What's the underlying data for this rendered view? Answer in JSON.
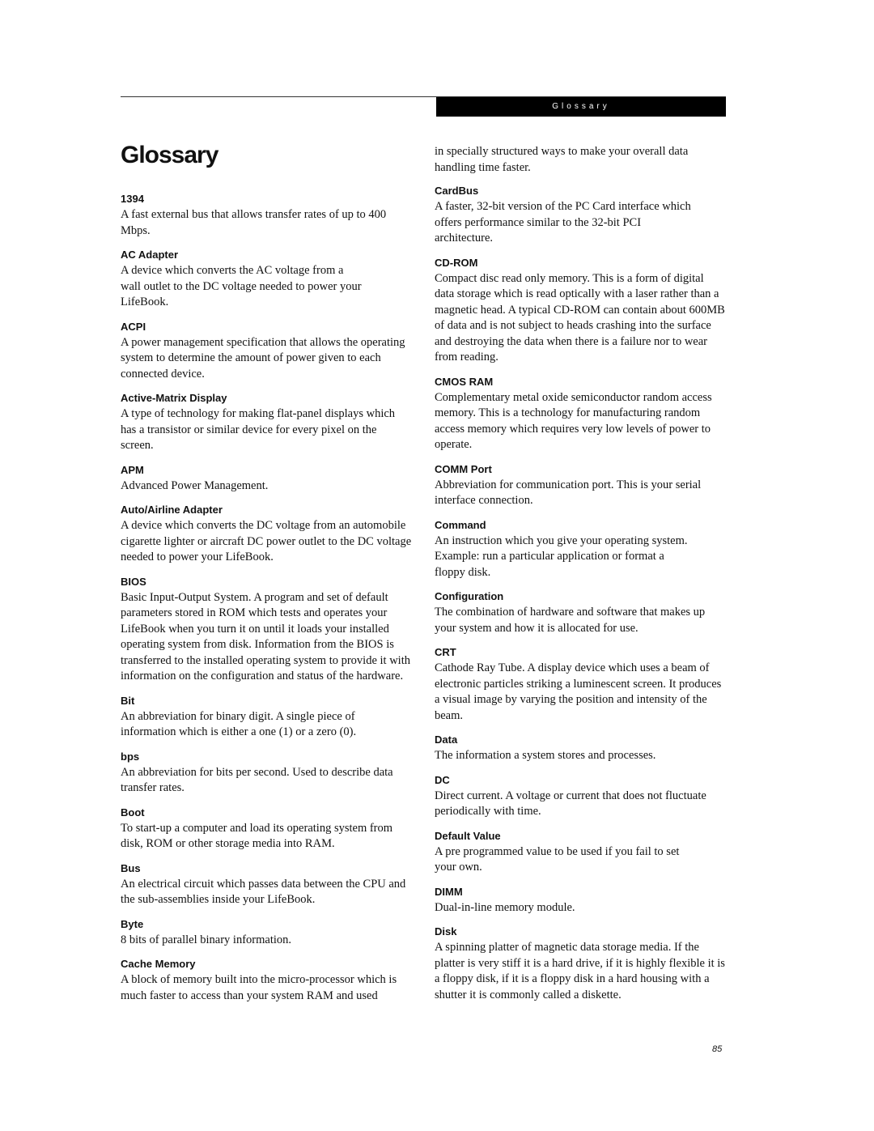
{
  "header": {
    "running_title": "Glossary"
  },
  "page": {
    "title": "Glossary",
    "number": "85"
  },
  "left_column": [
    {
      "term": "1394",
      "definition": "A fast external bus that allows transfer rates of up to 400 Mbps."
    },
    {
      "term": "AC Adapter",
      "definition": "A device which converts the AC voltage from a wall outlet to the DC voltage needed to power your LifeBook."
    },
    {
      "term": "ACPI",
      "definition": "A power management specification that allows the operating system to determine the amount of power given to each connected device."
    },
    {
      "term": "Active-Matrix Display",
      "definition": "A type of technology for making flat-panel displays which has a transistor or similar device for every pixel on the screen."
    },
    {
      "term": "APM",
      "definition": "Advanced Power Management."
    },
    {
      "term": "Auto/Airline Adapter",
      "definition": "A device which converts the DC voltage from an automobile cigarette lighter or aircraft DC power outlet to the DC voltage needed to power your LifeBook."
    },
    {
      "term": "BIOS",
      "definition": "Basic Input-Output System. A program and set of default parameters stored in ROM which tests and operates your LifeBook when you turn it on until it loads your installed operating system from disk. Information from the BIOS is transferred to the installed operating system to provide it with information on the configuration and status of the hardware."
    },
    {
      "term": "Bit",
      "definition": "An abbreviation for binary digit. A single piece of information which is either a one (1) or a zero (0)."
    },
    {
      "term": "bps",
      "definition": "An abbreviation for bits per second. Used to describe data transfer rates."
    },
    {
      "term": "Boot",
      "definition": "To start-up a computer and load its operating system from disk, ROM or other storage media into RAM."
    },
    {
      "term": "Bus",
      "definition": "An electrical circuit which passes data between the CPU and the sub-assemblies inside your LifeBook."
    },
    {
      "term": "Byte",
      "definition": "8 bits of parallel binary information."
    },
    {
      "term": "Cache Memory",
      "definition": "A block of memory built into the micro-processor which is much faster to access than your system RAM and used"
    }
  ],
  "right_column": {
    "continuation": "in specially structured ways to make your overall data handling time faster.",
    "entries": [
      {
        "term": "CardBus",
        "definition": "A faster, 32-bit version of the PC Card interface which offers performance similar to the 32-bit PCI architecture."
      },
      {
        "term": "CD-ROM",
        "definition": "Compact disc read only memory. This is a form of digital data storage which is read optically with a laser rather than a magnetic head. A typical CD-ROM can contain about 600MB of data and is not subject to heads crashing into the surface and destroying the data when there is a failure nor to wear from reading."
      },
      {
        "term": "CMOS RAM",
        "definition": "Complementary metal oxide semiconductor random access memory. This is a technology for manufacturing random access memory which requires very low levels of power to operate."
      },
      {
        "term": "COMM Port",
        "definition": "Abbreviation for communication port. This is your serial interface connection."
      },
      {
        "term": "Command",
        "definition": "An instruction which you give your operating system. Example: run a particular application or format a floppy disk."
      },
      {
        "term": "Configuration",
        "definition": "The combination of hardware and software that makes up your system and how it is allocated for use."
      },
      {
        "term": "CRT",
        "definition": "Cathode Ray Tube. A display device which uses a beam of electronic particles striking a luminescent screen. It produces a visual image by varying the position and intensity of the beam."
      },
      {
        "term": "Data",
        "definition": "The information a system stores and processes."
      },
      {
        "term": "DC",
        "definition": "Direct current. A voltage or current that does not fluctuate periodically with time."
      },
      {
        "term": "Default Value",
        "definition": "A pre programmed value to be used if you fail to set your own."
      },
      {
        "term": "DIMM",
        "definition": "Dual-in-line memory module."
      },
      {
        "term": "Disk",
        "definition": "A spinning platter of magnetic data storage media. If the platter is very stiff it is a hard drive, if it is highly flexible it is a floppy disk, if it is a floppy disk in a hard housing with a shutter it is commonly called a diskette."
      }
    ]
  }
}
